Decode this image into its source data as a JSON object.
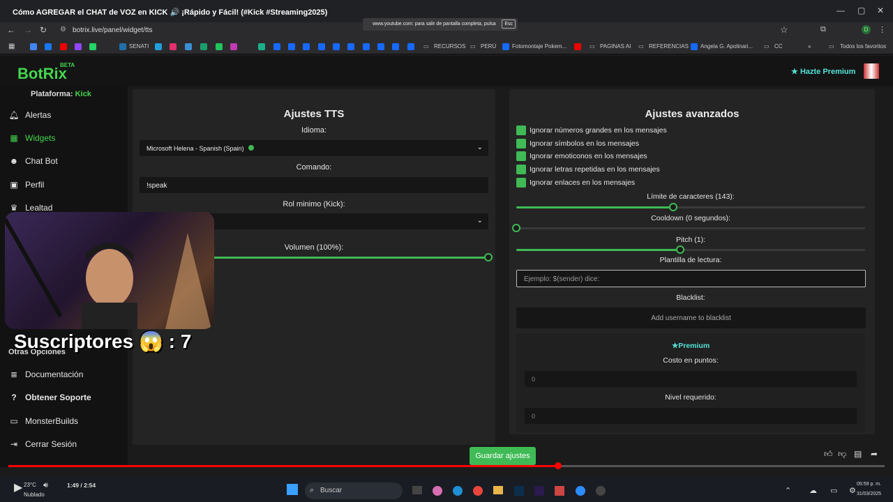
{
  "browser": {
    "video_title": "Cómo AGREGAR el CHAT de VOZ en KICK 🔊 ¡Rápido y Fácil! (#Kick #Streaming2025)",
    "url": "botrix.live/panel/widget/tts",
    "fullscreen_toast": "www.youtube.com: para salir de pantalla completa, pulsa",
    "fullscreen_key": "Esc",
    "bookmarks": [
      "SENATI",
      "RECURSOS",
      "PERÚ",
      "Fotomontaje Pokem...",
      "PAGINAS AI",
      "REFERENCIAS",
      "Angela G. Apolinari...",
      "CC",
      "Todos los favoritos"
    ]
  },
  "app": {
    "logo": "BotRix",
    "logo_badge": "BETA",
    "premium_cta": "Hazte Premium",
    "platform_label": "Plataforma:",
    "platform_value": "Kick"
  },
  "sidebar": {
    "items": [
      {
        "label": "Alertas",
        "icon": "bell-icon"
      },
      {
        "label": "Widgets",
        "icon": "widgets-icon",
        "active": true
      },
      {
        "label": "Chat Bot",
        "icon": "robot-icon"
      },
      {
        "label": "Perfil",
        "icon": "profile-icon"
      },
      {
        "label": "Lealtad",
        "icon": "trophy-icon"
      }
    ],
    "other_section": "Otras Opciones",
    "other_items": [
      {
        "label": "Documentación",
        "icon": "book-icon"
      },
      {
        "label": "Obtener Soporte",
        "icon": "help-icon"
      },
      {
        "label": "MonsterBuilds",
        "icon": "laptop-icon"
      },
      {
        "label": "Cerrar Sesión",
        "icon": "logout-icon"
      }
    ]
  },
  "tts": {
    "title": "Ajustes TTS",
    "language_label": "Idioma:",
    "language_value": "Microsoft Helena - Spanish (Spain)",
    "command_label": "Comando:",
    "command_value": "!speak",
    "role_label": "Rol minimo (Kick):",
    "volume_label": "Volumen (100%):",
    "volume_value": 100
  },
  "advanced": {
    "title": "Ajustes avanzados",
    "checkboxes": [
      "Ignorar números grandes en los mensajes",
      "Ignorar símbolos en los mensajes",
      "Ignorar emoticonos en los mensajes",
      "Ignorar letras repetidas en los mensajes",
      "Ignorar enlaces en los mensajes"
    ],
    "char_limit_label": "Límite de caracteres (143):",
    "char_limit_fraction": 0.45,
    "cooldown_label": "Cooldown (0 segundos):",
    "cooldown_fraction": 0.0,
    "pitch_label": "Pitch (1):",
    "pitch_fraction": 0.47,
    "template_label": "Plantilla de lectura:",
    "template_placeholder": "Ejemplo: $(sender) dice:",
    "blacklist_label": "Blacklist:",
    "blacklist_placeholder": "Add username to blacklist",
    "premium_title": "Premium",
    "cost_label": "Costo en puntos:",
    "cost_value": "0",
    "level_label": "Nivel requerido:",
    "level_value": "0"
  },
  "save_label": "Guardar ajustes",
  "overlay": {
    "subscribers": "Suscriptores 😱 : 7"
  },
  "player": {
    "time": "1:49 / 2:54",
    "progress": 0.627
  },
  "taskbar": {
    "search": "Buscar",
    "weather": "Nublado",
    "temp": "23°C",
    "time": "05:59 p. m.",
    "date": "31/03/2025"
  },
  "colors": {
    "accent": "#3fba55",
    "premium": "#52e3d7",
    "youtube_red": "#ff0000"
  }
}
